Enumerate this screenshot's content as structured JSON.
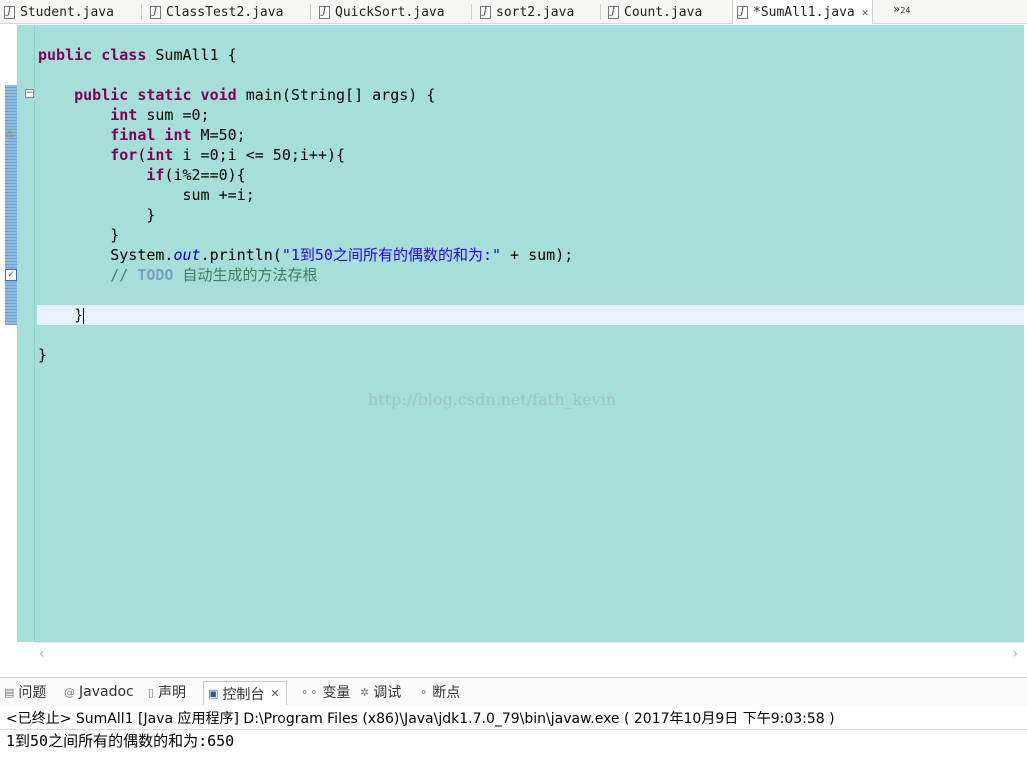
{
  "editor_tabs": [
    {
      "label": "Student.java",
      "active": false
    },
    {
      "label": "ClassTest2.java",
      "active": false
    },
    {
      "label": "QuickSort.java",
      "active": false
    },
    {
      "label": "sort2.java",
      "active": false
    },
    {
      "label": "Count.java",
      "active": false
    },
    {
      "label": "*SumAll1.java",
      "active": true
    }
  ],
  "tab_overflow": {
    "symbol": "»",
    "count": "24"
  },
  "code": {
    "line1": {
      "kw": "public class",
      "rest": " SumAll1 {"
    },
    "line3": {
      "indent": "    ",
      "kw": "public static void",
      "rest": " main(String[] args) {"
    },
    "line4": {
      "indent": "        ",
      "kw": "int",
      "rest": " sum =0;"
    },
    "line5": {
      "indent": "        ",
      "kw": "final int",
      "rest": " M=50;"
    },
    "line6": {
      "indent": "        ",
      "kw1": "for",
      "mid": "(",
      "kw2": "int",
      "rest": " i =0;i <= 50;i++){"
    },
    "line7": {
      "indent": "            ",
      "kw": "if",
      "rest": "(i%2==0){"
    },
    "line8": {
      "indent": "                ",
      "rest": "sum +=i;"
    },
    "line9": {
      "indent": "            ",
      "rest": "}"
    },
    "line10": {
      "indent": "        ",
      "rest": "}"
    },
    "line11": {
      "indent": "        ",
      "pre": "System.",
      "field": "out",
      "mid": ".println(",
      "str": "\"1到50之间所有的偶数的和为:\"",
      "rest": " + sum);"
    },
    "line12": {
      "indent": "        ",
      "pre": "// ",
      "todo": "TODO",
      "rest": " 自动生成的方法存根"
    },
    "line14": {
      "indent": "    ",
      "rest": "}"
    },
    "line16": {
      "rest": "}"
    }
  },
  "watermark": "http://blog.csdn.net/fath_kevin",
  "view_tabs": [
    {
      "label": "问题",
      "icon": "problems-icon",
      "active": false
    },
    {
      "label": "Javadoc",
      "icon": "javadoc-icon",
      "active": false
    },
    {
      "label": "声明",
      "icon": "declaration-icon",
      "active": false
    },
    {
      "label": "控制台",
      "icon": "console-icon",
      "active": true
    },
    {
      "label": "变量",
      "icon": "variables-icon",
      "active": false
    },
    {
      "label": "调试",
      "icon": "debug-icon",
      "active": false
    },
    {
      "label": "断点",
      "icon": "breakpoints-icon",
      "active": false
    }
  ],
  "console": {
    "title": "<已终止> SumAll1 [Java 应用程序] D:\\Program Files (x86)\\Java\\jdk1.7.0_79\\bin\\javaw.exe ( 2017年10月9日 下午9:03:58 )",
    "output": "1到50之间所有的偶数的和为:650"
  },
  "colors": {
    "editor_background": "#a6ded9",
    "current_line": "#e8f2fe",
    "keyword": "#7f0055",
    "string": "#2a00ff",
    "field": "#0000c0",
    "comment": "#3f7f5f",
    "todo": "#7f9fbf"
  }
}
